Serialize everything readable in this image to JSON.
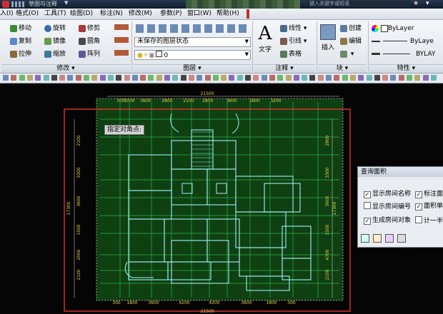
{
  "title": {
    "doc": "草图与注释",
    "search_placeholder": "键入关键字或短语"
  },
  "menu": [
    {
      "label": "入(I)"
    },
    {
      "label": "格式(O)"
    },
    {
      "label": "工具(T)"
    },
    {
      "label": "绘图(D)"
    },
    {
      "label": "标注(N)"
    },
    {
      "label": "修改(M)"
    },
    {
      "label": "参数(P)"
    },
    {
      "label": "窗口(W)"
    },
    {
      "label": "帮助(H)"
    }
  ],
  "ribbon": {
    "modify": {
      "title": "修改",
      "move": "移动",
      "rotate": "旋转",
      "trim": "修剪",
      "copy": "复制",
      "mirror": "镜像",
      "fillet": "圆角",
      "stretch": "拉伸",
      "scale": "缩放",
      "array": "阵列"
    },
    "layers": {
      "title": "图层",
      "layer_state": "未保存的图层状态",
      "current_layer": "0"
    },
    "annotation": {
      "title": "注释",
      "text": "文字",
      "linear": "线性",
      "leader": "引线",
      "table": "表格"
    },
    "block": {
      "title": "块",
      "insert": "插入",
      "create": "创建",
      "edit": "编辑"
    },
    "properties": {
      "title": "特性",
      "color": "ByLayer",
      "linetype": "ByLaye",
      "lineweight": "BYLAY"
    }
  },
  "drawing": {
    "prompt": "指定对角点:",
    "dim_top_total": "21500",
    "dim_bottom_total": "21500",
    "dims_top": [
      "300",
      "3000",
      "3600",
      "2800",
      "2100",
      "2800",
      "3600",
      "1800",
      "3200"
    ],
    "dims_left_total": "17300",
    "dims_right_total": "17300",
    "dims_left": [
      "2100",
      "3300",
      "3600",
      "1500",
      "2000",
      "2100"
    ],
    "dims_right": [
      "2900",
      "3300",
      "3600",
      "1500",
      "4700",
      "2100"
    ],
    "dims_bottom": [
      "300",
      "1800",
      "3600",
      "4200",
      "4200",
      "3600",
      "1800",
      "300"
    ]
  },
  "dialog": {
    "title": "查询面积",
    "opt1": "显示房间名称",
    "opt1_checked": true,
    "opt2": "标注面",
    "opt2_checked": true,
    "opt3": "显示房间编号",
    "opt3_checked": false,
    "opt4": "面积单",
    "opt4_checked": true,
    "opt5": "生成房间对象",
    "opt5_checked": true,
    "opt6": "计一半阳",
    "opt6_checked": false
  },
  "colors": {
    "accent_red": "#e53030",
    "grid_green": "#2cb24a",
    "dim_yellow": "#e0d24a",
    "wall_cyan": "#9ff0f0"
  }
}
